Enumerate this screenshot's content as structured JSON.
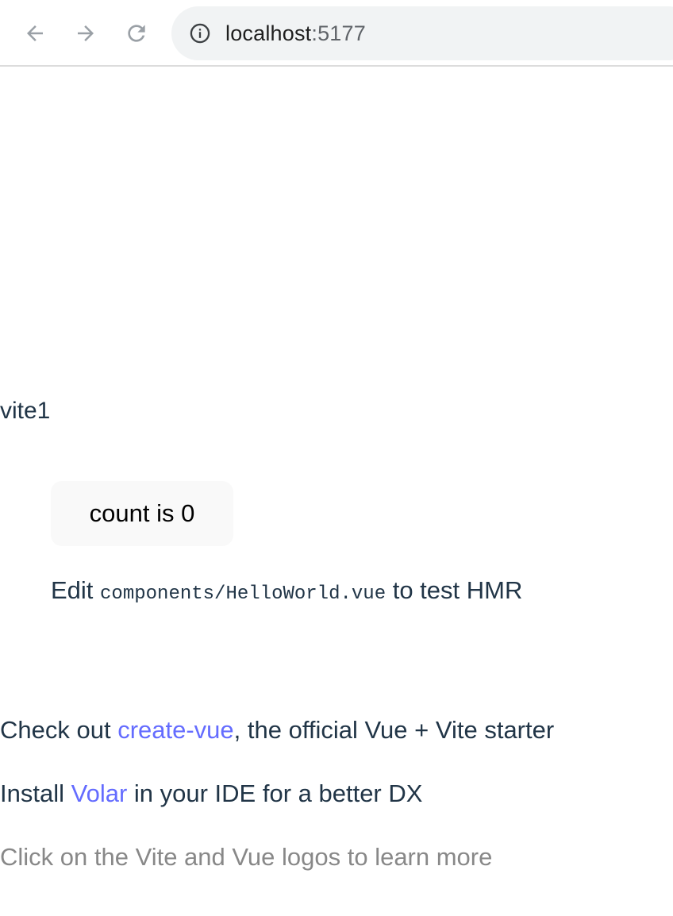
{
  "browser": {
    "url_host": "localhost",
    "url_port": ":5177",
    "icons": {
      "back": "arrow-left-icon",
      "forward": "arrow-right-icon",
      "reload": "reload-icon",
      "site_info": "info-icon"
    }
  },
  "page": {
    "heading": "vite1",
    "count_button_label": "count is 0",
    "hmr": {
      "prefix": "Edit ",
      "code": "components/HelloWorld.vue",
      "suffix": " to test HMR"
    },
    "create_vue_line": {
      "prefix": "Check out ",
      "link": "create-vue",
      "suffix": ", the official Vue + Vite starter"
    },
    "volar_line": {
      "prefix": "Install ",
      "link": "Volar",
      "suffix": " in your IDE for a better DX"
    },
    "docs_line": "Click on the Vite and Vue logos to learn more"
  },
  "colors": {
    "text": "#213547",
    "link": "#646cff",
    "muted": "#888888",
    "button_bg": "#f9f9f9",
    "omnibox_bg": "#f1f3f4"
  }
}
